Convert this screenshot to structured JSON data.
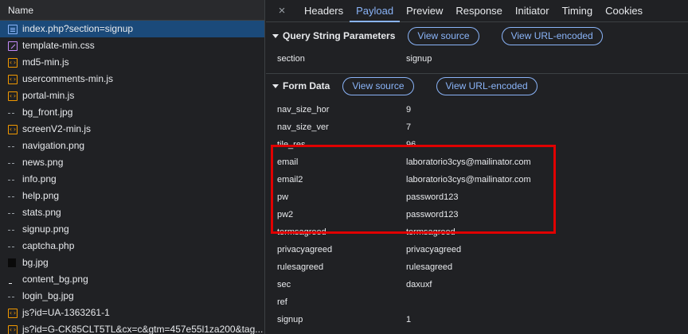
{
  "left": {
    "header": "Name",
    "rows": [
      {
        "name": "index.php?section=signup",
        "icon": "doc",
        "selected": true
      },
      {
        "name": "template-min.css",
        "icon": "css"
      },
      {
        "name": "md5-min.js",
        "icon": "js"
      },
      {
        "name": "usercomments-min.js",
        "icon": "js"
      },
      {
        "name": "portal-min.js",
        "icon": "js"
      },
      {
        "name": "bg_front.jpg",
        "icon": "img"
      },
      {
        "name": "screenV2-min.js",
        "icon": "js"
      },
      {
        "name": "navigation.png",
        "icon": "img"
      },
      {
        "name": "news.png",
        "icon": "img"
      },
      {
        "name": "info.png",
        "icon": "img"
      },
      {
        "name": "help.png",
        "icon": "img"
      },
      {
        "name": "stats.png",
        "icon": "img"
      },
      {
        "name": "signup.png",
        "icon": "img"
      },
      {
        "name": "captcha.php",
        "icon": "img"
      },
      {
        "name": "bg.jpg",
        "icon": "img-dark"
      },
      {
        "name": "content_bg.png",
        "icon": "img-dash"
      },
      {
        "name": "login_bg.jpg",
        "icon": "img"
      },
      {
        "name": "js?id=UA-1363261-1",
        "icon": "js"
      },
      {
        "name": "js?id=G-CK85CLT5TL&cx=c&gtm=457e55l1za200&tag...",
        "icon": "js"
      }
    ]
  },
  "tabs": {
    "close_icon": "×",
    "items": [
      "Headers",
      "Payload",
      "Preview",
      "Response",
      "Initiator",
      "Timing",
      "Cookies"
    ],
    "active": "Payload"
  },
  "query": {
    "title": "Query String Parameters",
    "view_source": "View source",
    "view_url_encoded": "View URL-encoded",
    "params": [
      {
        "key": "section",
        "value": "signup"
      }
    ]
  },
  "form": {
    "title": "Form Data",
    "view_source": "View source",
    "view_url_encoded": "View URL-encoded",
    "params": [
      {
        "key": "nav_size_hor",
        "value": "9"
      },
      {
        "key": "nav_size_ver",
        "value": "7"
      },
      {
        "key": "tile_res",
        "value": "96"
      },
      {
        "key": "email",
        "value": "laboratorio3cys@mailinator.com"
      },
      {
        "key": "email2",
        "value": "laboratorio3cys@mailinator.com"
      },
      {
        "key": "pw",
        "value": "password123"
      },
      {
        "key": "pw2",
        "value": "password123"
      },
      {
        "key": "termsagreed",
        "value": "termsagreed"
      },
      {
        "key": "privacyagreed",
        "value": "privacyagreed"
      },
      {
        "key": "rulesagreed",
        "value": "rulesagreed"
      },
      {
        "key": "sec",
        "value": "daxuxf"
      },
      {
        "key": "ref",
        "value": ""
      },
      {
        "key": "signup",
        "value": "1"
      }
    ]
  },
  "colors": {
    "accent": "#8ab4f8",
    "selected_row": "#1b4a7a",
    "highlight": "#e00000"
  }
}
